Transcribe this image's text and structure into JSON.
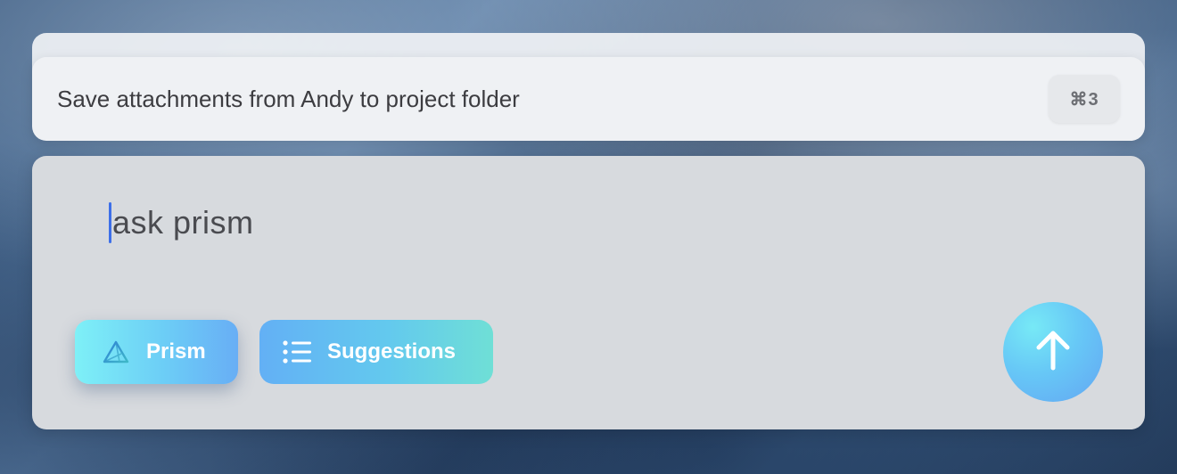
{
  "suggestion": {
    "text": "Save attachments from Andy to project folder",
    "shortcut": "⌘3"
  },
  "input": {
    "placeholder": "ask prism"
  },
  "modes": {
    "prism_label": "Prism",
    "suggestions_label": "Suggestions"
  },
  "colors": {
    "caret": "#3d6fe8",
    "accent_start": "#7ef0f7",
    "accent_end": "#68aef5"
  },
  "icons": {
    "prism": "prism-triangle-icon",
    "suggestions": "list-icon",
    "send": "arrow-up-icon"
  }
}
